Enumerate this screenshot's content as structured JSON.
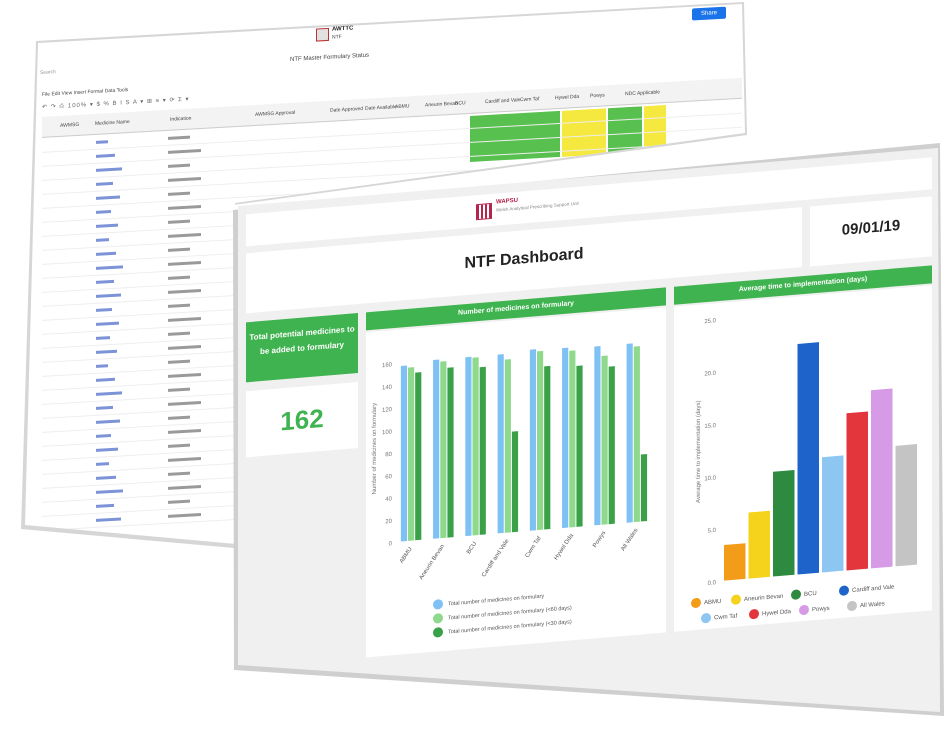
{
  "sheet": {
    "app_title": "AWTTC",
    "app_subtitle": "NTF",
    "doc_title": "NTF Master Formulary Status",
    "share_label": "Share",
    "menu": "File  Edit  View  Insert  Format  Data  Tools",
    "search_placeholder": "Search",
    "columns": [
      "AWMSG",
      "Medicine Name",
      "Indication",
      "AWMSG Approval",
      "Date Approved",
      "Date Available",
      "ABMU",
      "Aneurin Bevan",
      "BCU",
      "Cardiff and Vale",
      "Cwm Taf",
      "Hywel Dda",
      "Powys",
      "NDC Applicable"
    ],
    "row_count": 28
  },
  "dashboard": {
    "logo_text": "WAPSU",
    "logo_sub": "Welsh Analytical Prescribing Support Unit",
    "title": "NTF Dashboard",
    "date": "09/01/19",
    "kpi_label": "Total potential medicines to be added to formulary",
    "kpi_value": "162",
    "chart1_header": "Number of medicines on formulary",
    "chart2_header": "Average time to implementation (days)"
  },
  "chart_data": [
    {
      "type": "bar",
      "title": "Number of medicines on formulary",
      "ylabel": "Number of medicines on formulary",
      "categories": [
        "ABMU",
        "Aneurin Bevan",
        "BCU",
        "Cardiff and Vale",
        "Cwm Taf",
        "Hywel Dda",
        "Powys",
        "All Wales"
      ],
      "yticks": [
        0,
        20,
        40,
        60,
        80,
        100,
        120,
        140,
        160
      ],
      "ylim": [
        0,
        170
      ],
      "series": [
        {
          "name": "Total number of medicines on formulary",
          "color": "#7ec1f5",
          "values": [
            157,
            160,
            160,
            160,
            162,
            161,
            160,
            160
          ]
        },
        {
          "name": "Total number of medicines on formulary (<60 days)",
          "color": "#8ed98b",
          "values": [
            155,
            158,
            159,
            155,
            160,
            158,
            151,
            157
          ]
        },
        {
          "name": "Total number of medicines on formulary (<30 days)",
          "color": "#3aa148",
          "values": [
            150,
            152,
            150,
            90,
            146,
            144,
            141,
            60
          ]
        }
      ],
      "legend_position": "bottom"
    },
    {
      "type": "bar",
      "title": "Average time to implementation (days)",
      "ylabel": "Average time to implementation (days)",
      "yticks": [
        "0.0",
        "5.0",
        "10.0",
        "15.0",
        "20.0",
        "25.0"
      ],
      "ylim": [
        0,
        25
      ],
      "series": [
        {
          "name": "ABMU",
          "color": "#f39c1a",
          "value": 3.4
        },
        {
          "name": "Aneurin Bevan",
          "color": "#f5d21b",
          "value": 6.3
        },
        {
          "name": "BCU",
          "color": "#2d8a3e",
          "value": 10
        },
        {
          "name": "Cardiff and Vale",
          "color": "#1d63c9",
          "value": 22
        },
        {
          "name": "Cwm Taf",
          "color": "#8ec6f2",
          "value": 11
        },
        {
          "name": "Hywel Dda",
          "color": "#e2363c",
          "value": 15
        },
        {
          "name": "Powys",
          "color": "#d69ae6",
          "value": 17
        },
        {
          "name": "All Wales",
          "color": "#c4c4c4",
          "value": 11.5
        }
      ],
      "legend_position": "bottom"
    }
  ]
}
